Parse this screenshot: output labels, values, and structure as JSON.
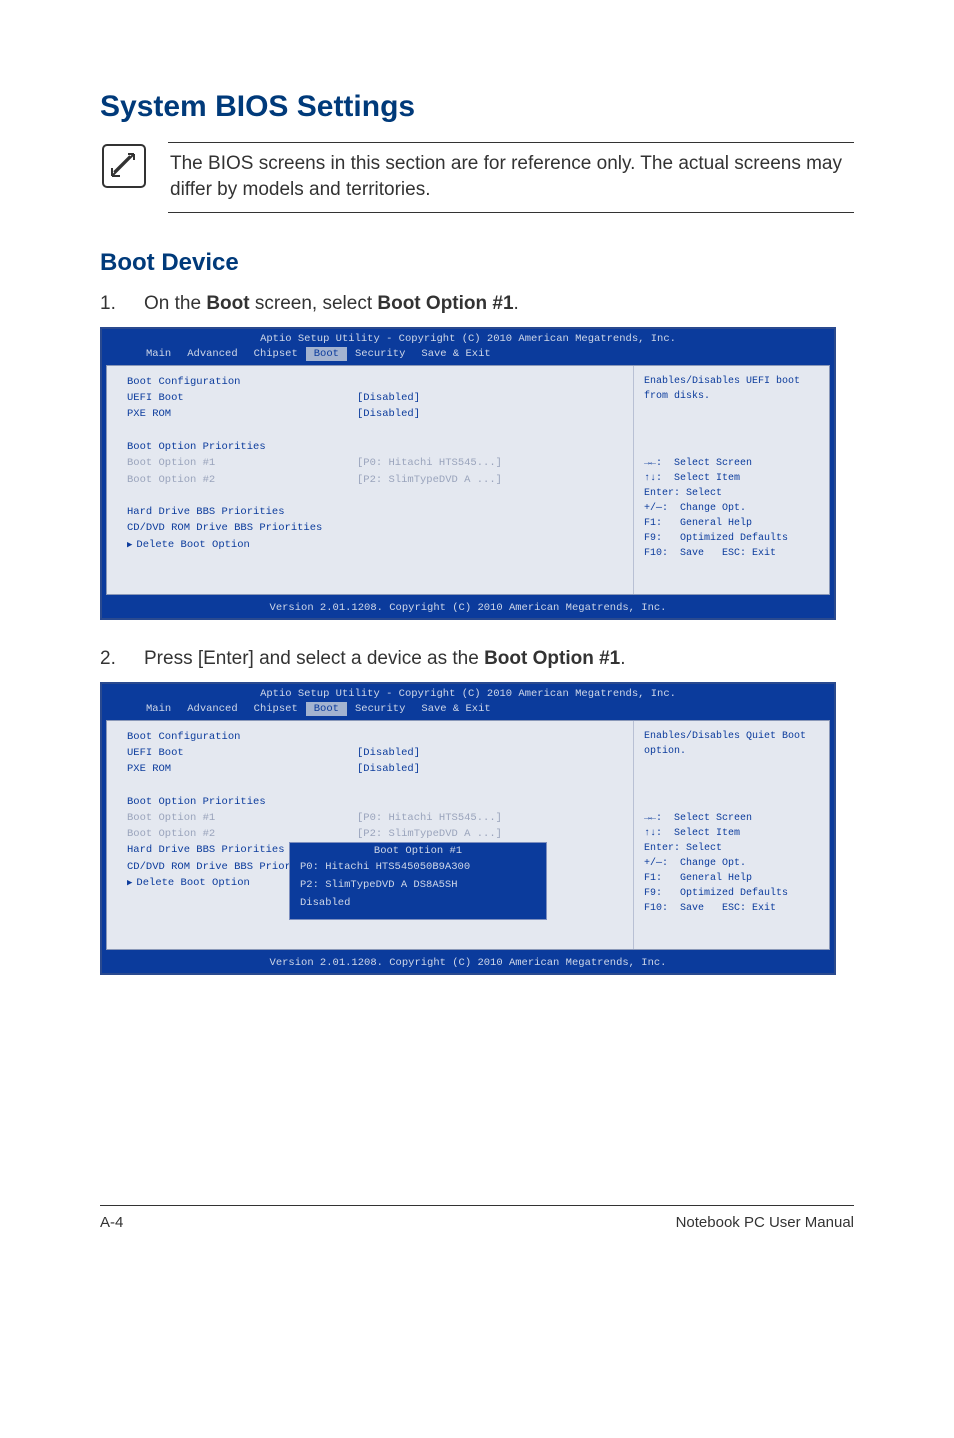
{
  "page": {
    "title": "System BIOS Settings",
    "note": "The BIOS screens in this section are for reference only. The actual screens may differ by models and territories.",
    "section_title": "Boot Device",
    "step1_num": "1.",
    "step1_pre": "On the ",
    "step1_b1": "Boot",
    "step1_mid": " screen, select ",
    "step1_b2": "Boot Option #1",
    "step1_post": ".",
    "step2_num": "2.",
    "step2_pre": "Press [Enter] and select a device as the ",
    "step2_b1": "Boot Option #1",
    "step2_post": "."
  },
  "bios": {
    "header": "Aptio Setup Utility - Copyright (C) 2010 American Megatrends, Inc.",
    "footer": "Version 2.01.1208. Copyright (C) 2010 American Megatrends, Inc.",
    "tabs": {
      "main": "Main",
      "advanced": "Advanced",
      "chipset": "Chipset",
      "boot": "Boot",
      "security": "Security",
      "save": "Save & Exit"
    },
    "left1": {
      "h1": "Boot Configuration",
      "uefi_l": "UEFI Boot",
      "uefi_v": "[Disabled]",
      "pxe_l": "PXE ROM",
      "pxe_v": "[Disabled]",
      "h2": "Boot Option Priorities",
      "bo1_l": "Boot Option #1",
      "bo1_v": "[P0: Hitachi HTS545...]",
      "bo2_l": "Boot Option #2",
      "bo2_v": "[P2: SlimTypeDVD A ...]",
      "hd": "Hard Drive BBS Priorities",
      "cd": "CD/DVD ROM Drive BBS Priorities",
      "del": "Delete Boot Option"
    },
    "right1": {
      "help": "Enables/Disables UEFI boot from disks."
    },
    "right2": {
      "help": "Enables/Disables Quiet Boot option."
    },
    "legend": {
      "l1": "→←:  Select Screen",
      "l2": "↑↓:  Select Item",
      "l3": "Enter: Select",
      "l4": "+/—:  Change Opt.",
      "l5": "F1:   General Help",
      "l6": "F9:   Optimized Defaults",
      "l7": "F10:  Save   ESC: Exit"
    },
    "popup": {
      "title": "Boot Option #1",
      "i1": "P0: Hitachi HTS545050B9A300",
      "i2": "P2: SlimTypeDVD A DS8A5SH",
      "i3": "Disabled"
    }
  },
  "footer": {
    "left": "A-4",
    "right": "Notebook PC User Manual"
  }
}
